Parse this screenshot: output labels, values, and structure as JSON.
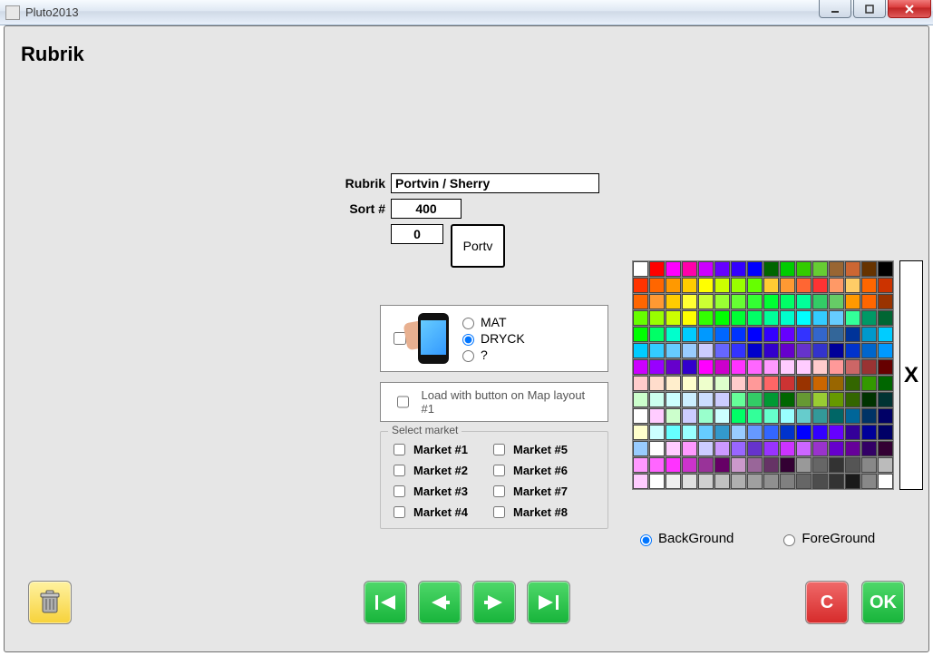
{
  "window": {
    "title": "Pluto2013"
  },
  "page": {
    "title": "Rubrik"
  },
  "form": {
    "rubrik_label": "Rubrik",
    "rubrik_value": "Portvin / Sherry",
    "sort_label": "Sort #",
    "sort_value": "400",
    "extra_value": "0",
    "preview_text": "Portv"
  },
  "category": {
    "options": [
      "MAT",
      "DRYCK",
      "?"
    ],
    "selected": "DRYCK",
    "opt_mat": "MAT",
    "opt_dryck": "DRYCK",
    "opt_q": "?"
  },
  "load": {
    "label": "Load with button on Map layout #1"
  },
  "market": {
    "legend": "Select market",
    "col1": [
      "Market #1",
      "Market #2",
      "Market #3",
      "Market #4"
    ],
    "col2": [
      "Market #5",
      "Market #6",
      "Market #7",
      "Market #8"
    ],
    "m1": "Market #1",
    "m2": "Market #2",
    "m3": "Market #3",
    "m4": "Market #4",
    "m5": "Market #5",
    "m6": "Market #6",
    "m7": "Market #7",
    "m8": "Market #8"
  },
  "palette_rows": [
    [
      "#ffffff",
      "#ff0000",
      "#ff00ff",
      "#ff00aa",
      "#cc00ff",
      "#6600ff",
      "#3300ff",
      "#0000ff",
      "#006600",
      "#00cc00",
      "#33cc00",
      "#66cc33",
      "#996633",
      "#cc6633",
      "#663300",
      "#000000"
    ],
    [
      "#ff3300",
      "#ff6600",
      "#ff9900",
      "#ffcc00",
      "#ffff00",
      "#ccff00",
      "#99ff00",
      "#66ff00",
      "#ffcc33",
      "#ff9933",
      "#ff6633",
      "#ff3333",
      "#ff9966",
      "#ffcc66",
      "#ff6600",
      "#cc3300"
    ],
    [
      "#ff6600",
      "#ff9933",
      "#ffcc00",
      "#ffff33",
      "#ccff33",
      "#99ff33",
      "#66ff33",
      "#33ff33",
      "#00ff33",
      "#00ff66",
      "#00ff99",
      "#33cc66",
      "#66cc66",
      "#ff9900",
      "#ff6600",
      "#993300"
    ],
    [
      "#66ff00",
      "#99ff00",
      "#ccff00",
      "#ffff00",
      "#33ff00",
      "#00ff00",
      "#00ff33",
      "#00ff66",
      "#00ff99",
      "#00ffcc",
      "#00ffff",
      "#33ccff",
      "#66ccff",
      "#33ff99",
      "#009966",
      "#006633"
    ],
    [
      "#00ff00",
      "#00ff66",
      "#00ffcc",
      "#00ccff",
      "#0099ff",
      "#0066ff",
      "#0033ff",
      "#0000ff",
      "#3300ff",
      "#6600ff",
      "#3333ff",
      "#3366cc",
      "#336699",
      "#003399",
      "#0099cc",
      "#00ccff"
    ],
    [
      "#00ccff",
      "#33ccff",
      "#66ccff",
      "#99ccff",
      "#ccccff",
      "#6666ff",
      "#3333ff",
      "#0000cc",
      "#3300cc",
      "#6600cc",
      "#6633cc",
      "#3333cc",
      "#000099",
      "#0033cc",
      "#0066cc",
      "#0099ff"
    ],
    [
      "#cc00ff",
      "#9900ff",
      "#6600cc",
      "#3300cc",
      "#ff00ff",
      "#cc00cc",
      "#ff33ff",
      "#ff66ff",
      "#ff99ff",
      "#ffccff",
      "#ffccff",
      "#ffcccc",
      "#ff9999",
      "#cc6666",
      "#993333",
      "#660000"
    ],
    [
      "#ffcccc",
      "#ffddcc",
      "#ffeecc",
      "#ffffcc",
      "#eeffcc",
      "#ddffcc",
      "#ffcccc",
      "#ff9999",
      "#ff6666",
      "#cc3333",
      "#993300",
      "#cc6600",
      "#996600",
      "#336600",
      "#339900",
      "#006600"
    ],
    [
      "#ccffcc",
      "#ccffee",
      "#ccffff",
      "#cceeff",
      "#ccddff",
      "#ccccff",
      "#66ff99",
      "#33cc66",
      "#009933",
      "#006600",
      "#669933",
      "#99cc33",
      "#669900",
      "#336600",
      "#003300",
      "#003333"
    ],
    [
      "#ffffff",
      "#ffccff",
      "#ccffcc",
      "#ccccff",
      "#99ffcc",
      "#ccffff",
      "#00ff66",
      "#33ff99",
      "#66ffcc",
      "#99ffff",
      "#66cccc",
      "#339999",
      "#006666",
      "#006699",
      "#003366",
      "#000066"
    ],
    [
      "#ffffcc",
      "#ccffff",
      "#66ffff",
      "#99ffff",
      "#66ccff",
      "#3399cc",
      "#99ccff",
      "#6699ff",
      "#3366ff",
      "#0033cc",
      "#0000ff",
      "#3300ff",
      "#6600ff",
      "#330099",
      "#000099",
      "#000066"
    ],
    [
      "#99ccff",
      "#ffffff",
      "#ffccff",
      "#ff99ff",
      "#ccccff",
      "#cc99ff",
      "#9966ff",
      "#6633cc",
      "#9933ff",
      "#cc33ff",
      "#cc66ff",
      "#9933cc",
      "#6600cc",
      "#660099",
      "#330066",
      "#330033"
    ],
    [
      "#ff99ff",
      "#ff66ff",
      "#ff33ff",
      "#cc33cc",
      "#993399",
      "#660066",
      "#cc99cc",
      "#996699",
      "#663366",
      "#330033",
      "#999999",
      "#666666",
      "#333333",
      "#555555",
      "#888888",
      "#bbbbbb"
    ],
    [
      "#ffccff",
      "#ffffff",
      "#f0f0f0",
      "#e0e0e0",
      "#d0d0d0",
      "#c0c0c0",
      "#b0b0b0",
      "#a0a0a0",
      "#909090",
      "#808080",
      "#666666",
      "#4d4d4d",
      "#333333",
      "#1a1a1a",
      "#888888",
      "#ffffff"
    ]
  ],
  "xbtn": {
    "label": "X"
  },
  "bgfg": {
    "bg_label": "BackGround",
    "fg_label": "ForeGround",
    "selected": "BackGround"
  },
  "buttons": {
    "cancel": "C",
    "ok": "OK"
  }
}
